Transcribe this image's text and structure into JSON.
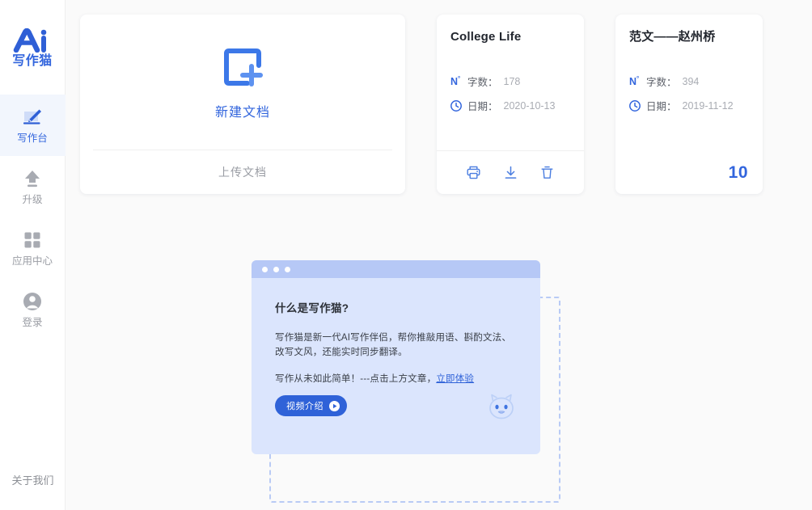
{
  "sidebar": {
    "logo": {
      "mark": "ai-logo-mark",
      "text": "写作猫"
    },
    "items": [
      {
        "icon": "pencil-edit-icon",
        "label": "写作台",
        "active": true
      },
      {
        "icon": "upload-arrow-icon",
        "label": "升级",
        "active": false
      },
      {
        "icon": "grid-squares-icon",
        "label": "应用中心",
        "active": false
      },
      {
        "icon": "user-avatar-icon",
        "label": "登录",
        "active": false
      }
    ],
    "about_label": "关于我们"
  },
  "new_doc_card": {
    "icon": "plus-square-icon",
    "new_label": "新建文档",
    "upload_label": "上传文档"
  },
  "documents": [
    {
      "title": "College Life",
      "word_count_icon": "number-sign-icon",
      "word_count_key": "字数：",
      "word_count_value": "178",
      "date_icon": "clock-icon",
      "date_key": "日期：",
      "date_value": "2020-10-13",
      "actions": [
        {
          "icon": "print-icon",
          "label": "打印"
        },
        {
          "icon": "download-icon",
          "label": "下载"
        },
        {
          "icon": "trash-icon",
          "label": "删除"
        }
      ],
      "count_badge": null
    },
    {
      "title": "范文——赵州桥",
      "word_count_icon": "number-sign-icon",
      "word_count_key": "字数：",
      "word_count_value": "394",
      "date_icon": "clock-icon",
      "date_key": "日期：",
      "date_value": "2019-11-12",
      "actions": [],
      "count_badge": "10"
    }
  ],
  "promo": {
    "heading": "什么是写作猫?",
    "paragraph1": "写作猫是新一代AI写作伴侣，帮你推敲用语、斟酌文法、改写文风，还能实时同步翻译。",
    "paragraph2_prefix": "写作从未如此简单！---点击上方文章，",
    "paragraph2_link": "立即体验",
    "cta_label": "视频介绍",
    "cta_icon": "play-circle-icon",
    "mascot_icon": "cat-face-icon",
    "window_dots": 3
  },
  "colors": {
    "accent": "#3265dd",
    "promo_bg": "#dbe5fd",
    "promo_titlebar": "#b6c8f6",
    "page_bg": "#fafafa",
    "dashed_border": "#b9cbf5"
  }
}
